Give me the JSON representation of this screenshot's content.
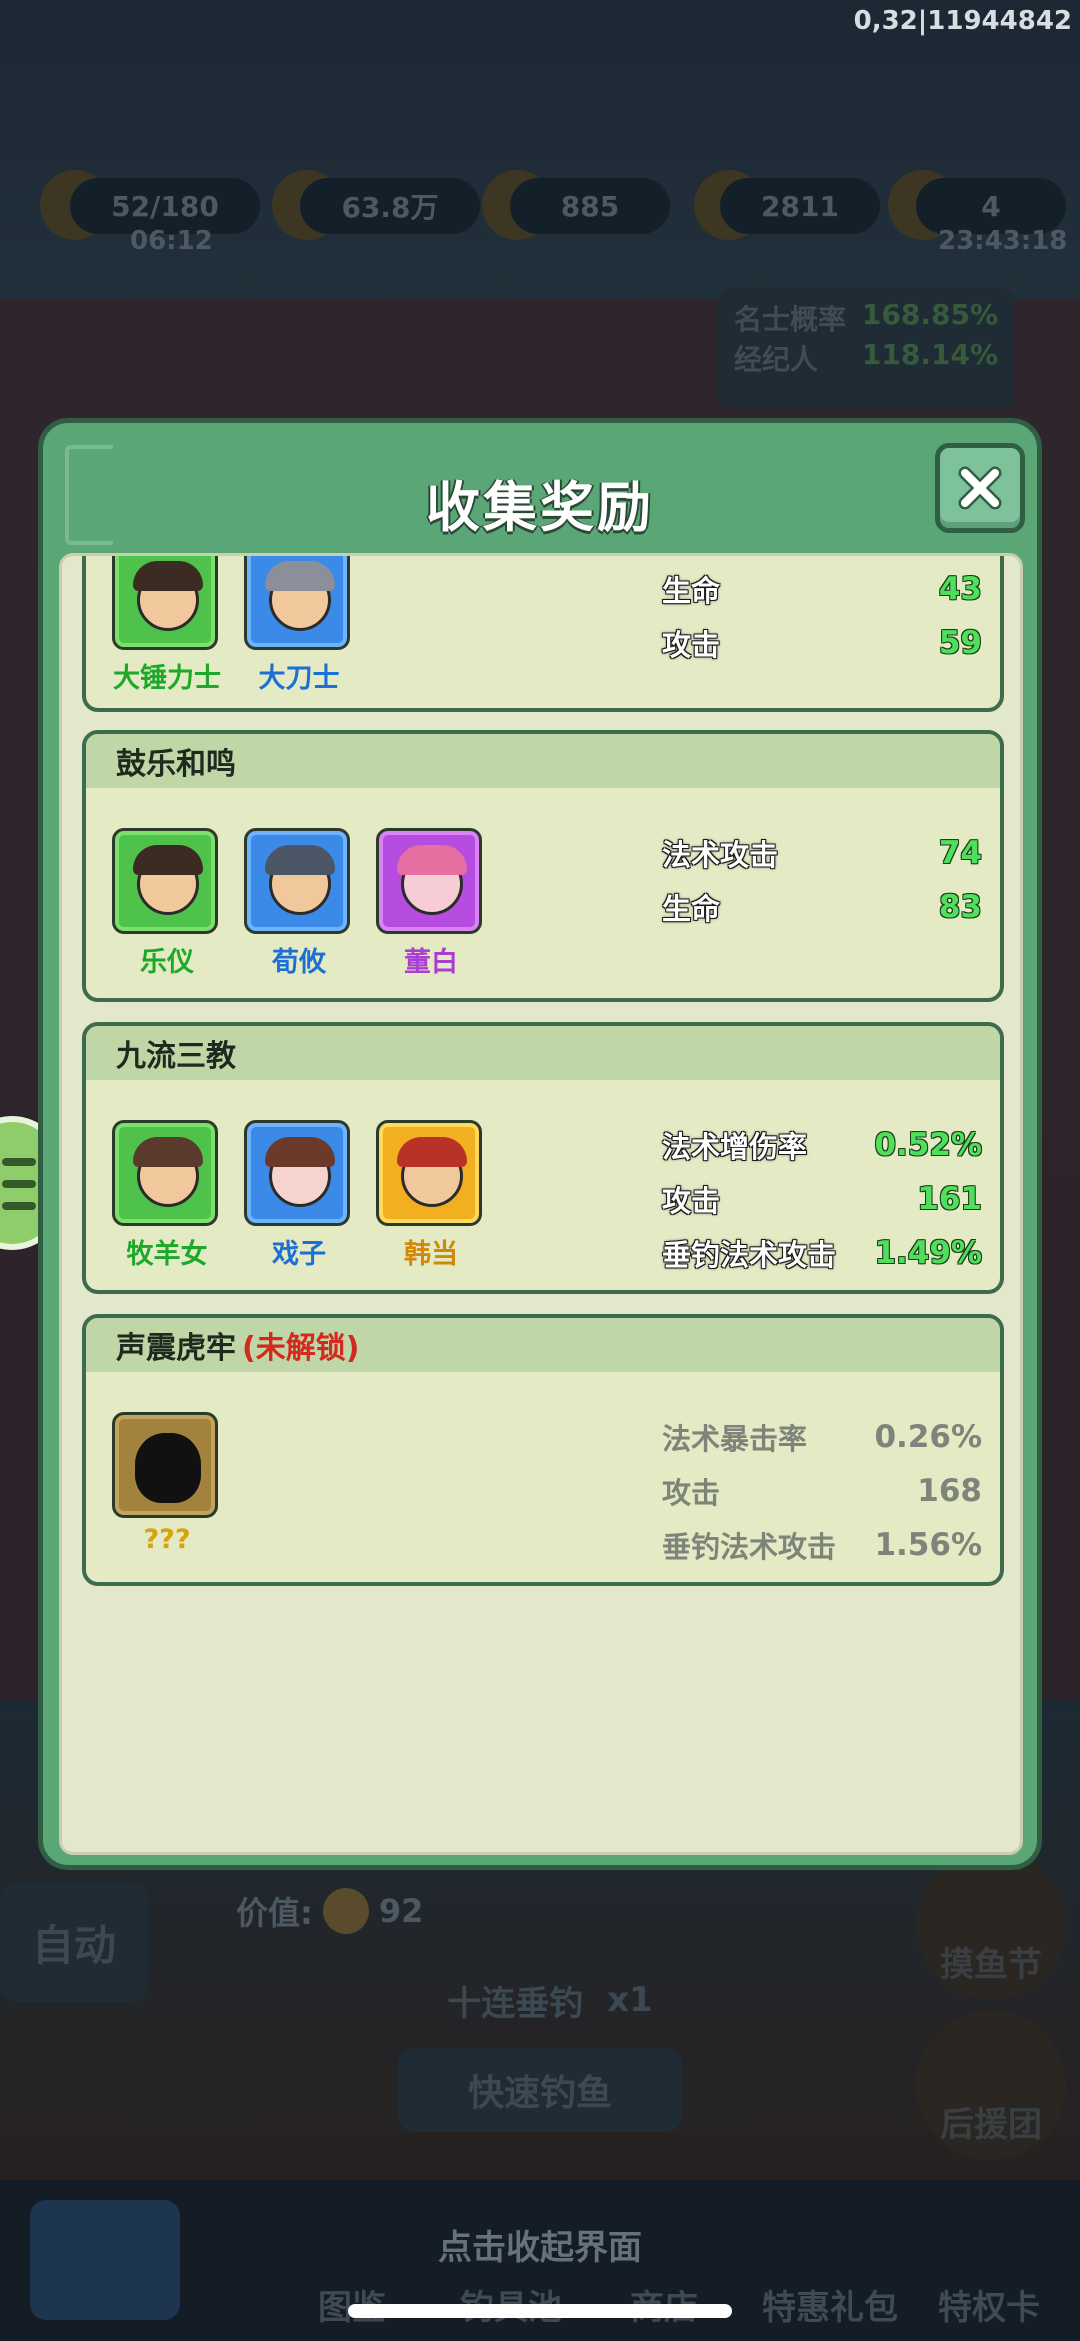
{
  "debug_text": "0,32|11944842",
  "background": {
    "resources": [
      "52/180",
      "63.8万",
      "885",
      "2811",
      "4"
    ],
    "timer_left": "06:12",
    "timer_right": "23:43:18",
    "stats": [
      {
        "label": "名士概率",
        "value": "168.85%"
      },
      {
        "label": "经纪人",
        "value": "118.14%"
      }
    ],
    "value_label": "价值:",
    "value_amount": "92",
    "auto_label": "自动",
    "ten_fish_label": "十连垂钓",
    "ten_fish_cost": "x1",
    "quick_fish_label": "快速钓鱼",
    "right_buttons": [
      "摸鱼节",
      "后援团"
    ],
    "tabs": [
      "图鉴",
      "钓具池",
      "商店",
      "特惠礼包",
      "特权卡"
    ],
    "collapse_hint": "点击收起界面"
  },
  "modal": {
    "title": "收集奖励",
    "groups": [
      {
        "name": "",
        "heroes": [
          {
            "name": "大锤力士",
            "rarity": "green"
          },
          {
            "name": "大刀士",
            "rarity": "blue"
          }
        ],
        "stats": [
          {
            "label": "生命",
            "value": "43"
          },
          {
            "label": "攻击",
            "value": "59"
          }
        ]
      },
      {
        "name": "鼓乐和鸣",
        "heroes": [
          {
            "name": "乐仪",
            "rarity": "green"
          },
          {
            "name": "荀攸",
            "rarity": "blue"
          },
          {
            "name": "董白",
            "rarity": "purple"
          }
        ],
        "stats": [
          {
            "label": "法术攻击",
            "value": "74"
          },
          {
            "label": "生命",
            "value": "83"
          }
        ]
      },
      {
        "name": "九流三教",
        "heroes": [
          {
            "name": "牧羊女",
            "rarity": "green"
          },
          {
            "name": "戏子",
            "rarity": "blue"
          },
          {
            "name": "韩当",
            "rarity": "gold"
          }
        ],
        "stats": [
          {
            "label": "法术增伤率",
            "value": "0.52%"
          },
          {
            "label": "攻击",
            "value": "161"
          },
          {
            "label": "垂钓法术攻击",
            "value": "1.49%"
          }
        ]
      },
      {
        "name": "声震虎牢",
        "locked_label": "(未解锁)",
        "heroes": [
          {
            "name": "???",
            "rarity": "dark"
          }
        ],
        "stats": [
          {
            "label": "法术暴击率",
            "value": "0.26%"
          },
          {
            "label": "攻击",
            "value": "168"
          },
          {
            "label": "垂钓法术攻击",
            "value": "1.56%"
          }
        ]
      }
    ]
  }
}
